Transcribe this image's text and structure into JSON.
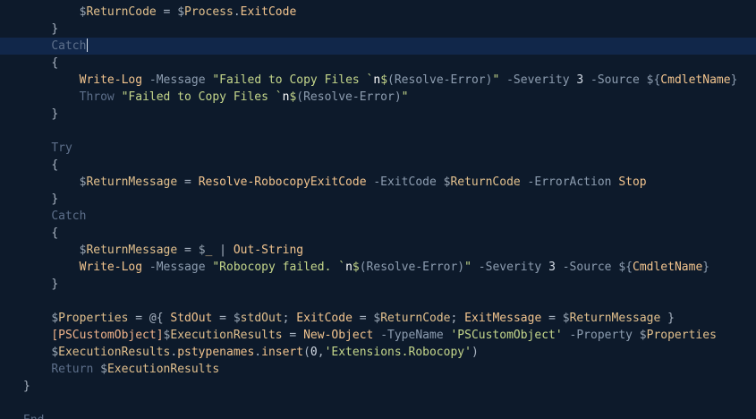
{
  "editor": {
    "current_line_index": 2,
    "lines": [
      {
        "indent": 8,
        "tokens": [
          [
            "var",
            "$"
          ],
          [
            "varname",
            "ReturnCode"
          ],
          [
            "op",
            " = "
          ],
          [
            "var",
            "$"
          ],
          [
            "varname",
            "Process"
          ],
          [
            "punct",
            "."
          ],
          [
            "cmdlet",
            "ExitCode"
          ]
        ]
      },
      {
        "indent": 4,
        "tokens": [
          [
            "punct",
            "}"
          ]
        ]
      },
      {
        "indent": 4,
        "tokens": [
          [
            "keyword",
            "Catch"
          ]
        ],
        "cursor": true
      },
      {
        "indent": 4,
        "tokens": [
          [
            "punct",
            "{"
          ]
        ]
      },
      {
        "indent": 8,
        "tokens": [
          [
            "cmdlet",
            "Write-Log"
          ],
          [
            "param",
            " -Message "
          ],
          [
            "string",
            "\"Failed to Copy Files `"
          ],
          [
            "escape",
            "n"
          ],
          [
            "string",
            "$"
          ],
          [
            "sub",
            "(Resolve-Error)"
          ],
          [
            "string",
            "\""
          ],
          [
            "param",
            " -Severity "
          ],
          [
            "number",
            "3"
          ],
          [
            "param",
            " -Source "
          ],
          [
            "sub",
            "${"
          ],
          [
            "cmdlet",
            "CmdletName"
          ],
          [
            "sub",
            "}"
          ]
        ]
      },
      {
        "indent": 8,
        "tokens": [
          [
            "keyword",
            "Throw "
          ],
          [
            "string",
            "\"Failed to Copy Files `"
          ],
          [
            "escape",
            "n"
          ],
          [
            "string",
            "$"
          ],
          [
            "sub",
            "(Resolve-Error)"
          ],
          [
            "string",
            "\""
          ]
        ]
      },
      {
        "indent": 4,
        "tokens": [
          [
            "punct",
            "}"
          ]
        ]
      },
      {
        "indent": 0,
        "tokens": []
      },
      {
        "indent": 4,
        "tokens": [
          [
            "keyword",
            "Try"
          ]
        ]
      },
      {
        "indent": 4,
        "tokens": [
          [
            "punct",
            "{"
          ]
        ]
      },
      {
        "indent": 8,
        "tokens": [
          [
            "var",
            "$"
          ],
          [
            "varname",
            "ReturnMessage"
          ],
          [
            "op",
            " = "
          ],
          [
            "cmdlet",
            "Resolve-RobocopyExitCode"
          ],
          [
            "param",
            " -ExitCode "
          ],
          [
            "var",
            "$"
          ],
          [
            "varname",
            "ReturnCode"
          ],
          [
            "param",
            " -ErrorAction "
          ],
          [
            "cmdlet",
            "Stop"
          ]
        ]
      },
      {
        "indent": 4,
        "tokens": [
          [
            "punct",
            "}"
          ]
        ]
      },
      {
        "indent": 4,
        "tokens": [
          [
            "keyword",
            "Catch"
          ]
        ]
      },
      {
        "indent": 4,
        "tokens": [
          [
            "punct",
            "{"
          ]
        ]
      },
      {
        "indent": 8,
        "tokens": [
          [
            "var",
            "$"
          ],
          [
            "varname",
            "ReturnMessage"
          ],
          [
            "op",
            " = "
          ],
          [
            "var",
            "$"
          ],
          [
            "varname",
            "_"
          ],
          [
            "op",
            " | "
          ],
          [
            "cmdlet",
            "Out-String"
          ]
        ]
      },
      {
        "indent": 8,
        "tokens": [
          [
            "cmdlet",
            "Write-Log"
          ],
          [
            "param",
            " -Message "
          ],
          [
            "string",
            "\"Robocopy failed. `"
          ],
          [
            "escape",
            "n"
          ],
          [
            "string",
            "$"
          ],
          [
            "sub",
            "(Resolve-Error)"
          ],
          [
            "string",
            "\""
          ],
          [
            "param",
            " -Severity "
          ],
          [
            "number",
            "3"
          ],
          [
            "param",
            " -Source "
          ],
          [
            "sub",
            "${"
          ],
          [
            "cmdlet",
            "CmdletName"
          ],
          [
            "sub",
            "}"
          ]
        ]
      },
      {
        "indent": 4,
        "tokens": [
          [
            "punct",
            "}"
          ]
        ]
      },
      {
        "indent": 0,
        "tokens": []
      },
      {
        "indent": 4,
        "tokens": [
          [
            "var",
            "$"
          ],
          [
            "varname",
            "Properties"
          ],
          [
            "op",
            " = "
          ],
          [
            "punct",
            "@{ "
          ],
          [
            "cmdlet",
            "StdOut"
          ],
          [
            "op",
            " = "
          ],
          [
            "var",
            "$"
          ],
          [
            "varname",
            "stdOut"
          ],
          [
            "punct",
            "; "
          ],
          [
            "cmdlet",
            "ExitCode"
          ],
          [
            "op",
            " = "
          ],
          [
            "var",
            "$"
          ],
          [
            "varname",
            "ReturnCode"
          ],
          [
            "punct",
            "; "
          ],
          [
            "cmdlet",
            "ExitMessage"
          ],
          [
            "op",
            " = "
          ],
          [
            "var",
            "$"
          ],
          [
            "varname",
            "ReturnMessage"
          ],
          [
            "punct",
            " }"
          ]
        ]
      },
      {
        "indent": 4,
        "tokens": [
          [
            "type",
            "[PSCustomObject]"
          ],
          [
            "var",
            "$"
          ],
          [
            "varname",
            "ExecutionResults"
          ],
          [
            "op",
            " = "
          ],
          [
            "cmdlet",
            "New-Object"
          ],
          [
            "param",
            " -TypeName "
          ],
          [
            "string",
            "'PSCustomObject'"
          ],
          [
            "param",
            " -Property "
          ],
          [
            "var",
            "$"
          ],
          [
            "varname",
            "Properties"
          ]
        ]
      },
      {
        "indent": 4,
        "tokens": [
          [
            "var",
            "$"
          ],
          [
            "varname",
            "ExecutionResults"
          ],
          [
            "punct",
            "."
          ],
          [
            "cmdlet",
            "pstypenames"
          ],
          [
            "punct",
            "."
          ],
          [
            "cmdlet",
            "insert"
          ],
          [
            "punct",
            "("
          ],
          [
            "number",
            "0"
          ],
          [
            "punct",
            ","
          ],
          [
            "string",
            "'Extensions.Robocopy'"
          ],
          [
            "punct",
            ")"
          ]
        ]
      },
      {
        "indent": 4,
        "tokens": [
          [
            "keyword",
            "Return "
          ],
          [
            "var",
            "$"
          ],
          [
            "varname",
            "ExecutionResults"
          ]
        ]
      },
      {
        "indent": 0,
        "tokens": [
          [
            "punct",
            "}"
          ]
        ]
      },
      {
        "indent": 0,
        "tokens": []
      },
      {
        "indent": 0,
        "tokens": [
          [
            "keyword",
            "End"
          ]
        ]
      }
    ]
  }
}
